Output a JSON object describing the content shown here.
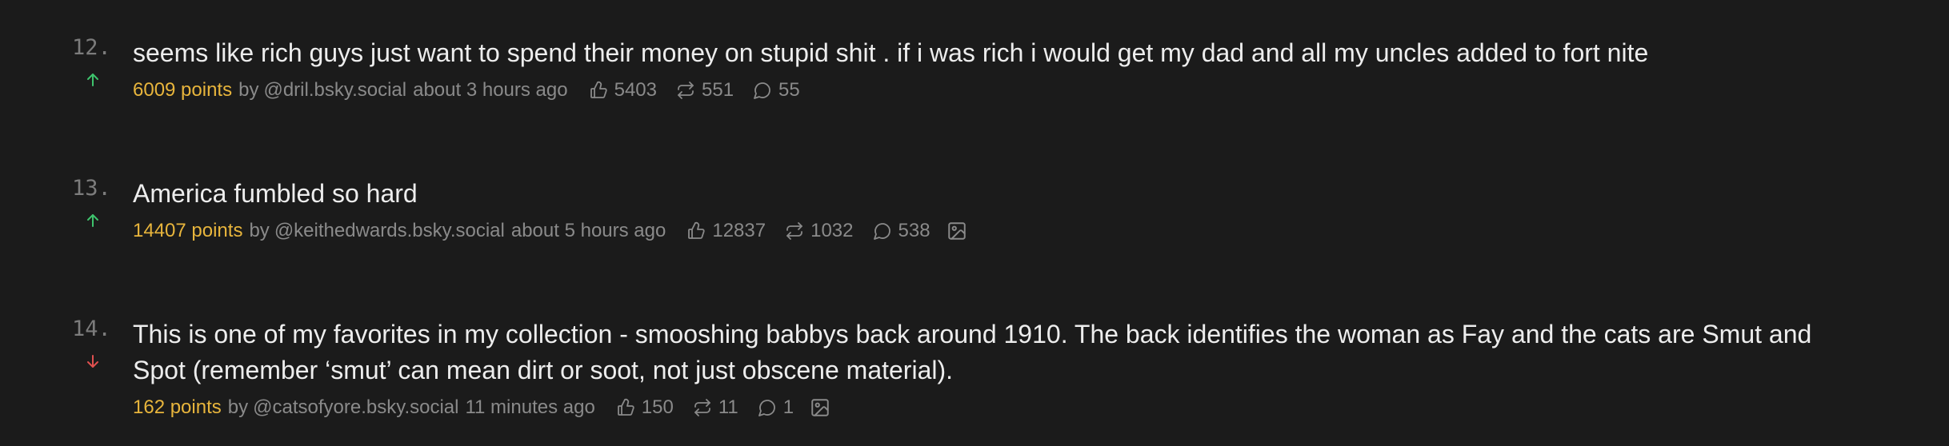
{
  "posts": [
    {
      "rank": "12.",
      "vote": "up",
      "title": "seems like rich guys just want to spend their money on stupid shit . if i was rich i would get my dad and all my uncles added to fort nite",
      "points": "6009 points",
      "by": "by",
      "author": "@dril.bsky.social",
      "time": "about 3 hours ago",
      "likes": "5403",
      "reposts": "551",
      "replies": "55",
      "has_image": false
    },
    {
      "rank": "13.",
      "vote": "up",
      "title": "America fumbled so hard",
      "points": "14407 points",
      "by": "by",
      "author": "@keithedwards.bsky.social",
      "time": "about 5 hours ago",
      "likes": "12837",
      "reposts": "1032",
      "replies": "538",
      "has_image": true
    },
    {
      "rank": "14.",
      "vote": "down",
      "title": "This is one of my favorites in my collection - smooshing babbys back around 1910. The back identifies the woman as Fay and the cats are Smut and Spot (remember ‘smut’ can mean dirt or soot, not just obscene material).",
      "points": "162 points",
      "by": "by",
      "author": "@catsofyore.bsky.social",
      "time": "11 minutes ago",
      "likes": "150",
      "reposts": "11",
      "replies": "1",
      "has_image": true
    }
  ],
  "colors": {
    "background": "#1b1b1b",
    "points": "#e8b53c",
    "vote_up": "#3ec46d",
    "vote_down": "#e0504f",
    "muted": "#8a8a8a"
  },
  "icons": {
    "like": "thumbs-up-icon",
    "repost": "repost-icon",
    "reply": "comment-icon",
    "image": "image-icon",
    "up": "arrow-up-icon",
    "down": "arrow-down-icon"
  }
}
